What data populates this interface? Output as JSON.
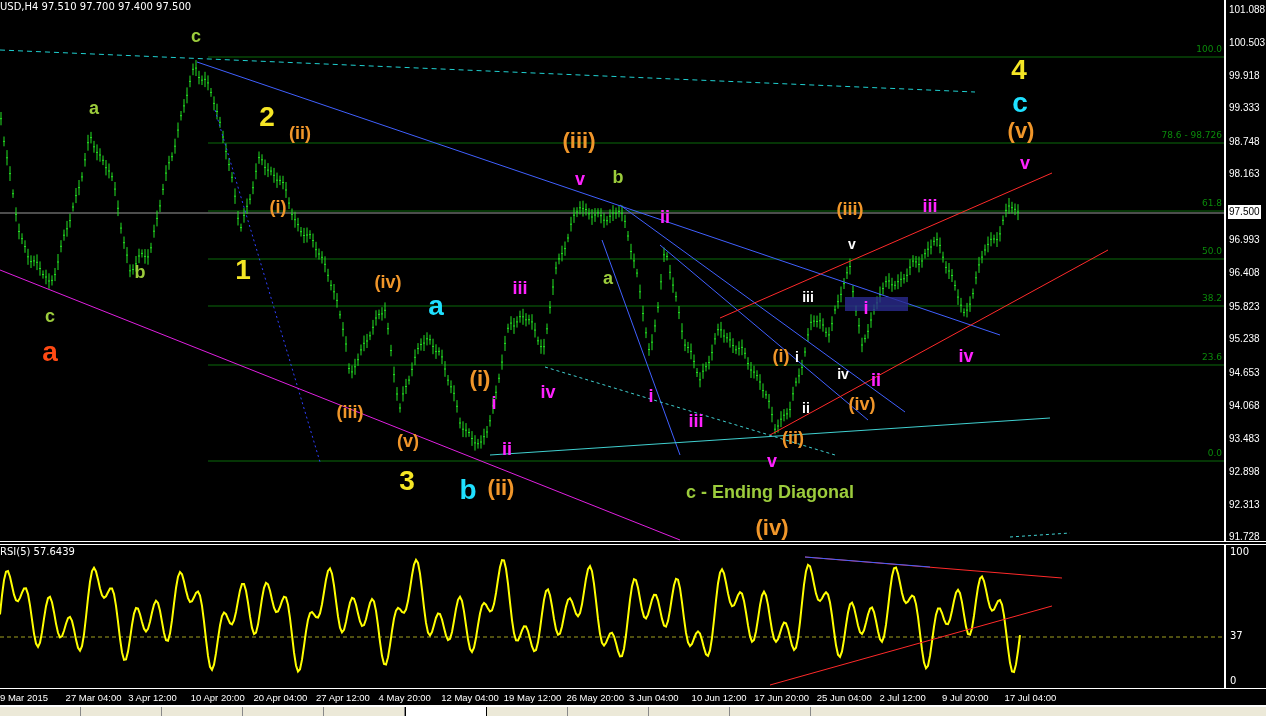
{
  "header": {
    "symbol_quote": "USD,H4 97.510 97.700 97.400 97.500"
  },
  "price_axis": {
    "ticks": [
      "101.088",
      "100.503",
      "99.918",
      "99.333",
      "98.748",
      "98.163",
      "96.993",
      "96.408",
      "95.823",
      "95.238",
      "94.653",
      "94.068",
      "93.483",
      "92.898",
      "92.313",
      "91.728"
    ],
    "current_price": "97.500"
  },
  "fib_levels": [
    "100.0",
    "78.6 - 98.726",
    "61.8",
    "50.0",
    "38.2",
    "23.6",
    "0.0"
  ],
  "wave_labels": [
    {
      "text": "a",
      "color": "#ff4a14",
      "kind": "major"
    },
    {
      "text": "1",
      "color": "#f5e625",
      "kind": "major"
    },
    {
      "text": "2",
      "color": "#f5e625",
      "kind": "major"
    },
    {
      "text": "3",
      "color": "#f5e625",
      "kind": "major"
    },
    {
      "text": "4",
      "color": "#f5e625",
      "kind": "major"
    },
    {
      "text": "a",
      "color": "#1fe0ff",
      "kind": "major"
    },
    {
      "text": "b",
      "color": "#1fe0ff",
      "kind": "major"
    },
    {
      "text": "c",
      "color": "#1fe0ff",
      "kind": "major"
    },
    {
      "text": "(ii)",
      "color": "#f0962a",
      "kind": "minor"
    },
    {
      "text": "(i)",
      "color": "#f0962a",
      "kind": "minor"
    },
    {
      "text": "(iv)",
      "color": "#f0962a",
      "kind": "minor"
    },
    {
      "text": "(iii)",
      "color": "#f0962a",
      "kind": "minor"
    },
    {
      "text": "(v)",
      "color": "#f0962a",
      "kind": "minor"
    },
    {
      "text": "(i)",
      "color": "#f0962a",
      "kind": "medium"
    },
    {
      "text": "(ii)",
      "color": "#f0962a",
      "kind": "medium"
    },
    {
      "text": "(iii)",
      "color": "#f0962a",
      "kind": "medium"
    },
    {
      "text": "(iv)",
      "color": "#f0962a",
      "kind": "medium"
    },
    {
      "text": "(iii)",
      "color": "#f0962a",
      "kind": "minor"
    },
    {
      "text": "(i)",
      "color": "#f0962a",
      "kind": "minor"
    },
    {
      "text": "(iv)",
      "color": "#f0962a",
      "kind": "minor"
    },
    {
      "text": "(ii)",
      "color": "#f0962a",
      "kind": "minor"
    },
    {
      "text": "(v)",
      "color": "#f0962a",
      "kind": "medium"
    },
    {
      "text": "c",
      "color": "#9ccc3c",
      "kind": "minor"
    },
    {
      "text": "a",
      "color": "#9ccc3c",
      "kind": "minor"
    },
    {
      "text": "b",
      "color": "#9ccc3c",
      "kind": "minor"
    },
    {
      "text": "c",
      "color": "#9ccc3c",
      "kind": "minor"
    },
    {
      "text": "b",
      "color": "#9ccc3c",
      "kind": "minor"
    },
    {
      "text": "a",
      "color": "#9ccc3c",
      "kind": "minor"
    },
    {
      "text": "c - Ending Diagonal",
      "color": "#9ccc3c",
      "kind": "minor"
    },
    {
      "text": "v",
      "color": "#ff22ff",
      "kind": "minor"
    },
    {
      "text": "ii",
      "color": "#ff22ff",
      "kind": "minor"
    },
    {
      "text": "iii",
      "color": "#ff22ff",
      "kind": "minor"
    },
    {
      "text": "iv",
      "color": "#ff22ff",
      "kind": "minor"
    },
    {
      "text": "i",
      "color": "#ff22ff",
      "kind": "minor"
    },
    {
      "text": "ii",
      "color": "#ff22ff",
      "kind": "minor"
    },
    {
      "text": "i",
      "color": "#ff22ff",
      "kind": "minor"
    },
    {
      "text": "iii",
      "color": "#ff22ff",
      "kind": "minor"
    },
    {
      "text": "v",
      "color": "#ff22ff",
      "kind": "minor"
    },
    {
      "text": "iii",
      "color": "#ff22ff",
      "kind": "minor"
    },
    {
      "text": "v",
      "color": "#ff22ff",
      "kind": "minor"
    },
    {
      "text": "iv",
      "color": "#ff22ff",
      "kind": "minor"
    },
    {
      "text": "ii",
      "color": "#ff22ff",
      "kind": "minor"
    },
    {
      "text": "i",
      "color": "#ff22ff",
      "kind": "minor"
    },
    {
      "text": "v",
      "color": "#ffffff",
      "kind": "micro"
    },
    {
      "text": "iii",
      "color": "#ffffff",
      "kind": "micro"
    },
    {
      "text": "iv",
      "color": "#ffffff",
      "kind": "micro"
    },
    {
      "text": "i",
      "color": "#ffffff",
      "kind": "micro"
    },
    {
      "text": "ii",
      "color": "#ffffff",
      "kind": "micro"
    }
  ],
  "rsi": {
    "title": "RSI(5) 57.6439",
    "ticks": [
      "100",
      "37",
      "0"
    ]
  },
  "time_axis": [
    "9 Mar 2015",
    "27 Mar 04:00",
    "3 Apr 12:00",
    "10 Apr 20:00",
    "20 Apr 04:00",
    "27 Apr 12:00",
    "4 May 20:00",
    "12 May 04:00",
    "19 May 12:00",
    "26 May 20:00",
    "3 Jun 04:00",
    "10 Jun 12:00",
    "17 Jun 20:00",
    "25 Jun 04:00",
    "2 Jul 12:00",
    "9 Jul 20:00",
    "17 Jul 04:00"
  ],
  "tabs": [
    {
      "selected": false
    },
    {
      "selected": false
    },
    {
      "selected": false
    },
    {
      "selected": false
    },
    {
      "selected": false
    },
    {
      "selected": true
    },
    {
      "selected": false
    },
    {
      "selected": false
    },
    {
      "selected": false
    },
    {
      "selected": false
    }
  ]
}
